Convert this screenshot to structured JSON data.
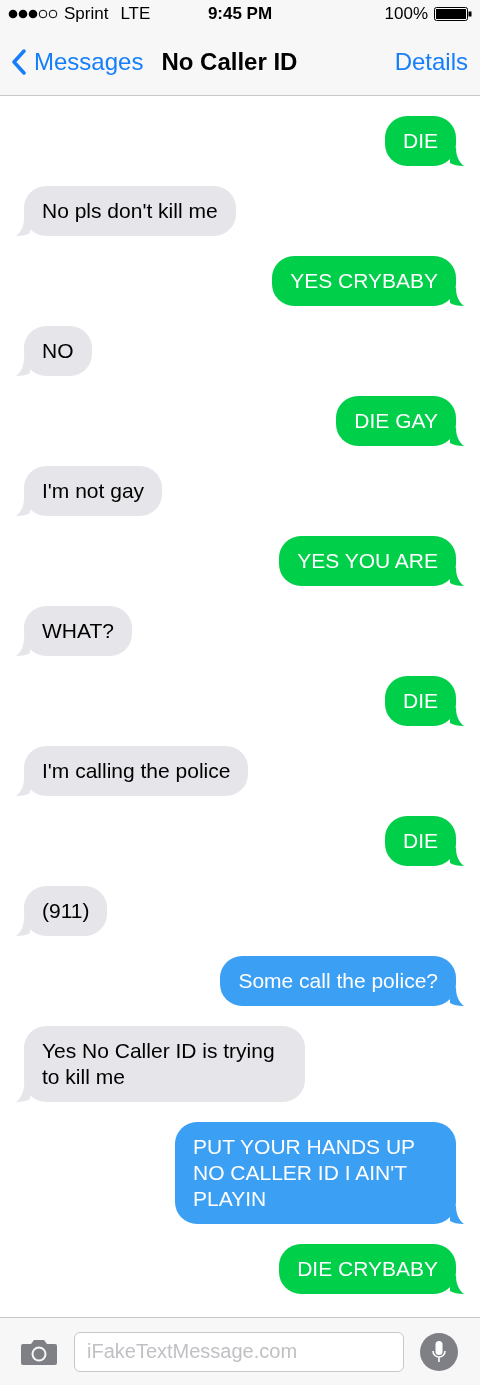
{
  "status_bar": {
    "carrier": "Sprint",
    "network": "LTE",
    "time": "9:45 PM",
    "battery": "100%"
  },
  "nav_bar": {
    "back": "Messages",
    "title": "No Caller ID",
    "action": "Details"
  },
  "messages": [
    {
      "kind": "sent",
      "text": "DIE",
      "color": "#00cf4a"
    },
    {
      "kind": "received",
      "text": "No pls don't kill me",
      "color": "#e5e5ea"
    },
    {
      "kind": "sent",
      "text": "YES CRYBABY",
      "color": "#00cf4a"
    },
    {
      "kind": "received",
      "text": "NO",
      "color": "#e5e5ea"
    },
    {
      "kind": "sent",
      "text": "DIE GAY",
      "color": "#00cf4a"
    },
    {
      "kind": "received",
      "text": "I'm not gay",
      "color": "#e5e5ea"
    },
    {
      "kind": "sent",
      "text": "YES YOU ARE",
      "color": "#00cf4a"
    },
    {
      "kind": "received",
      "text": "WHAT?",
      "color": "#e5e5ea"
    },
    {
      "kind": "sent",
      "text": "DIE",
      "color": "#00cf4a"
    },
    {
      "kind": "received",
      "text": "I'm calling the police",
      "color": "#e5e5ea"
    },
    {
      "kind": "sent",
      "text": "DIE",
      "color": "#00cf4a"
    },
    {
      "kind": "received",
      "text": "(911)",
      "color": "#e5e5ea"
    },
    {
      "kind": "sent",
      "text": "Some call the police?",
      "color": "#3b9ff4"
    },
    {
      "kind": "received",
      "text": "Yes No Caller ID is trying to kill me",
      "color": "#e5e5ea"
    },
    {
      "kind": "sent",
      "text": "PUT YOUR HANDS UP NO CALLER ID I AIN'T PLAYIN",
      "color": "#3b9ff4"
    },
    {
      "kind": "sent",
      "text": "DIE CRYBABY",
      "color": "#00cf4a"
    }
  ],
  "composer": {
    "placeholder": "iFakeTextMessage.com"
  }
}
